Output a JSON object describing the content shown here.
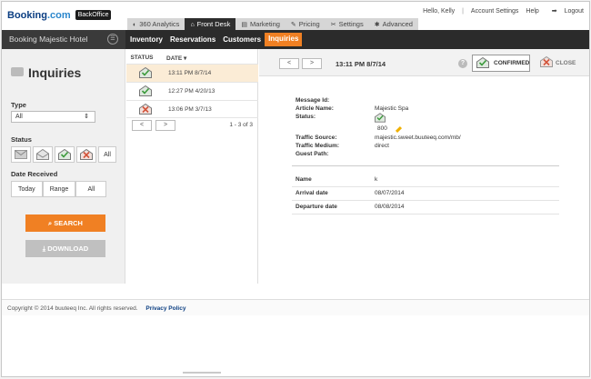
{
  "brand": {
    "name_main": "Booking",
    "name_dot": ".com",
    "badge": "BackOffice"
  },
  "user_links": {
    "greeting": "Hello, Kelly",
    "sep": "|",
    "account": "Account Settings",
    "help": "Help",
    "logout": "Logout"
  },
  "main_tabs": [
    {
      "icon": "◐",
      "label": "360 Analytics"
    },
    {
      "icon": "⌂",
      "label": "Front Desk"
    },
    {
      "icon": "▤",
      "label": "Marketing"
    },
    {
      "icon": "✎",
      "label": "Pricing"
    },
    {
      "icon": "✂",
      "label": "Settings"
    },
    {
      "icon": "✱",
      "label": "Advanced"
    }
  ],
  "hotel": {
    "name": "Booking Majestic Hotel",
    "btn": "☰"
  },
  "subnav": [
    "Inventory",
    "Reservations",
    "Customers",
    "Inquiries"
  ],
  "sidebar": {
    "title": "Inquiries",
    "type_label": "Type",
    "type_value": "All",
    "status_label": "Status",
    "status_all": "All",
    "date_label": "Date Received",
    "date_buttons": [
      "Today",
      "Range",
      "All"
    ],
    "search": "⌕  SEARCH",
    "download": "⤓  DOWNLOAD"
  },
  "list": {
    "headers": {
      "status": "STATUS",
      "date": "DATE ▾"
    },
    "rows": [
      {
        "date": "13:11 PM 8/7/14",
        "status": "confirmed"
      },
      {
        "date": "12:27 PM 4/20/13",
        "status": "confirmed"
      },
      {
        "date": "13:06 PM 3/7/13",
        "status": "closed"
      }
    ],
    "prev": "<",
    "next": ">",
    "count": "1 - 3 of 3"
  },
  "detail": {
    "prev": "<",
    "next": ">",
    "time": "13:11 PM 8/7/14",
    "help": "?",
    "confirmed": "CONFIRMED",
    "close": "CLOSE",
    "fields": {
      "message_id_label": "Message Id:",
      "article_name_label": "Article Name:",
      "article_name": "Majestic Spa",
      "status_label": "Status:",
      "status_code": "800",
      "traffic_source_label": "Traffic Source:",
      "traffic_source": "majestic.sweet.buuteeq.com/mb/",
      "traffic_medium_label": "Traffic Medium:",
      "traffic_medium": "direct",
      "guest_path_label": "Guest Path:"
    },
    "table": [
      {
        "label": "Name",
        "value": "k"
      },
      {
        "label": "Arrival date",
        "value": "08/07/2014"
      },
      {
        "label": "Departure date",
        "value": "08/08/2014"
      }
    ]
  },
  "footer": {
    "copyright": "Copyright © 2014 buuteeq Inc. All rights reserved.",
    "privacy": "Privacy Policy"
  },
  "colors": {
    "accent": "#f08023",
    "nav_dark": "#2b2b2b",
    "brand_blue": "#0b3e82",
    "confirm_green": "#3a9a3a",
    "close_red": "#d2543a"
  }
}
